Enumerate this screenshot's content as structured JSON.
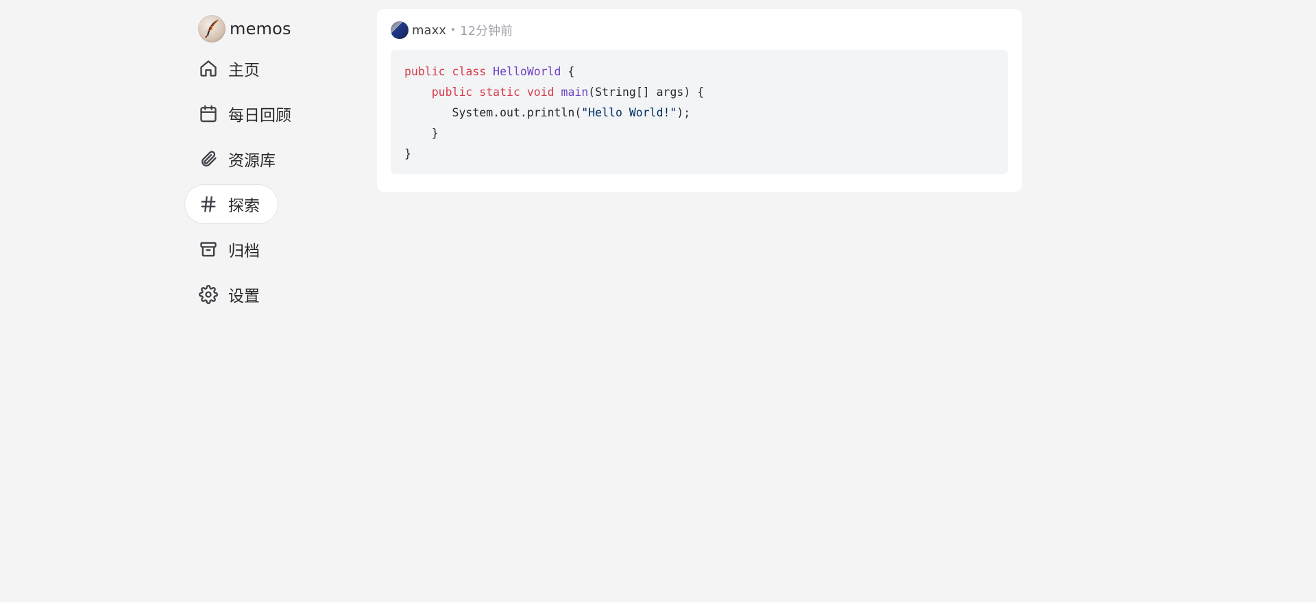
{
  "app": {
    "name": "memos",
    "logo_icon": "quill-icon"
  },
  "nav": {
    "items": [
      {
        "label": "主页",
        "icon": "home-icon",
        "active": false
      },
      {
        "label": "每日回顾",
        "icon": "calendar-icon",
        "active": false
      },
      {
        "label": "资源库",
        "icon": "paperclip-icon",
        "active": false
      },
      {
        "label": "探索",
        "icon": "hash-icon",
        "active": true
      },
      {
        "label": "归档",
        "icon": "archive-icon",
        "active": false
      },
      {
        "label": "设置",
        "icon": "gear-icon",
        "active": false
      }
    ]
  },
  "memo": {
    "author": "maxx",
    "separator": "•",
    "time": "12分钟前",
    "code": {
      "line1": {
        "kw1": "public",
        "kw2": "class",
        "name": "HelloWorld",
        "rest": " {"
      },
      "line2": {
        "indent": "    ",
        "kw1": "public",
        "kw2": "static",
        "kw3": "void",
        "name": "main",
        "rest": "(String[] args) {"
      },
      "line3": {
        "indent": "       ",
        "pre": "System.out.println(",
        "str": "\"Hello World!\"",
        "post": ");"
      },
      "line4": {
        "text": "    }"
      },
      "line5": {
        "text": "}"
      }
    }
  },
  "colors": {
    "background": "#f4f4f5",
    "card": "#ffffff",
    "code_bg": "#f3f4f6",
    "keyword": "#d73a49",
    "title": "#6f42c1",
    "string": "#032f62",
    "muted": "#a1a1aa"
  }
}
